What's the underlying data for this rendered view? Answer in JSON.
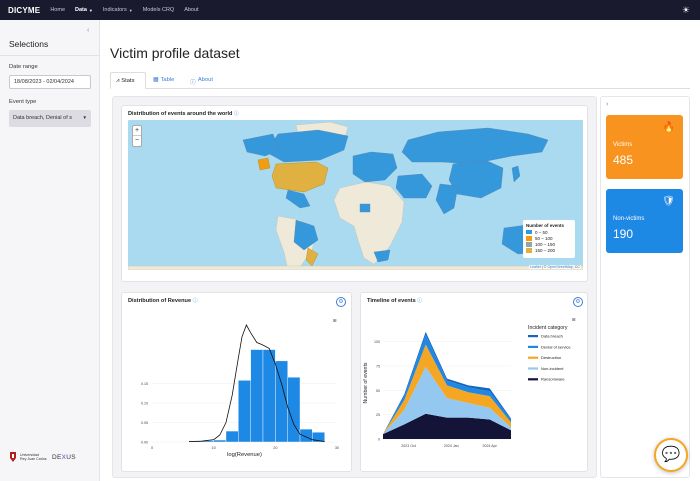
{
  "navbar": {
    "brand": "DICYME",
    "items": [
      {
        "label": "Home"
      },
      {
        "label": "Data",
        "active": true,
        "dropdown": true
      },
      {
        "label": "Indicators",
        "dropdown": true
      },
      {
        "label": "Models CRQ"
      },
      {
        "label": "About"
      }
    ],
    "theme_icon": "sun-icon"
  },
  "sidebar": {
    "title": "Selections",
    "date_range_label": "Date range",
    "date_range_value": "18/08/2023 - 02/04/2024",
    "event_type_label": "Event type",
    "event_type_value": "Data breach, Denial of s",
    "logo_urjc_line1": "Universidad",
    "logo_urjc_line2": "Rey Juan Carlos",
    "logo_dexus_pre": "DE",
    "logo_dexus_mid": "X",
    "logo_dexus_post": "US"
  },
  "page": {
    "title": "Victim profile dataset",
    "tabs": [
      {
        "label": "Stats",
        "icon": "chart-icon",
        "active": true
      },
      {
        "label": "Table",
        "icon": "table-icon"
      },
      {
        "label": "About",
        "icon": "info-icon"
      }
    ]
  },
  "map_card": {
    "title": "Distribution of events around the world",
    "zoom_in": "+",
    "zoom_out": "−",
    "legend_title": "Number of events",
    "legend": [
      {
        "label": "0 – 50",
        "color": "#3498db"
      },
      {
        "label": "50 – 100",
        "color": "#f39c12"
      },
      {
        "label": "100 – 150",
        "color": "#95a5a6"
      },
      {
        "label": "150 – 200",
        "color": "#e0b040"
      }
    ],
    "attribution_a": "Leaflet",
    "attribution_sep": " | © ",
    "attribution_b": "OpenStreetMap",
    "attribution_c": ", CC"
  },
  "revenue_card": {
    "title": "Distribution of Revenue"
  },
  "timeline_card": {
    "title": "Timeline of events"
  },
  "stats": {
    "victims_label": "Victims",
    "victims_value": "485",
    "victims_color": "#f7931e",
    "nonvictims_label": "Non-victims",
    "nonvictims_value": "190",
    "nonvictims_color": "#1e88e5"
  },
  "chart_data": [
    {
      "type": "bar",
      "title": "Distribution of Revenue",
      "xlabel": "log(Revenue)",
      "ylabel": "",
      "bin_edges": [
        4,
        6,
        8,
        10,
        12,
        14,
        16,
        18,
        20,
        22,
        24,
        26,
        28
      ],
      "values": [
        0.0,
        0.003,
        0.003,
        0.005,
        0.028,
        0.158,
        0.237,
        0.237,
        0.208,
        0.166,
        0.033,
        0.025
      ],
      "density_curve": [
        [
          6,
          0.001
        ],
        [
          8,
          0.002
        ],
        [
          10,
          0.006
        ],
        [
          11,
          0.018
        ],
        [
          12,
          0.05
        ],
        [
          13,
          0.12
        ],
        [
          14,
          0.215
        ],
        [
          14.6,
          0.27
        ],
        [
          15.3,
          0.3
        ],
        [
          16,
          0.28
        ],
        [
          17,
          0.255
        ],
        [
          17.8,
          0.25
        ],
        [
          19,
          0.24
        ],
        [
          20,
          0.2
        ],
        [
          21,
          0.15
        ],
        [
          22,
          0.09
        ],
        [
          23,
          0.045
        ],
        [
          24,
          0.02
        ],
        [
          26,
          0.006
        ],
        [
          28,
          0.001
        ]
      ],
      "xlim": [
        0,
        30
      ],
      "ylim": [
        0,
        0.3
      ],
      "xticks": [
        0,
        10,
        20,
        30
      ],
      "yticks": [
        0,
        0.05,
        0.1,
        0.15
      ],
      "bar_color": "#1e88e5"
    },
    {
      "type": "area",
      "stacked": true,
      "title": "Timeline of events",
      "ylabel": "Number of events",
      "x": [
        0,
        1,
        2,
        3,
        4,
        5,
        6
      ],
      "x_ticks": [
        {
          "pos": 1.2,
          "label": "2023 Oct"
        },
        {
          "pos": 3.2,
          "label": "2024 Jan"
        },
        {
          "pos": 5.0,
          "label": "2024 Apr"
        }
      ],
      "legend_title": "Incident category",
      "series": [
        {
          "name": "Ransomware",
          "color": "#141438",
          "values": [
            5,
            15,
            26,
            22,
            22,
            20,
            9
          ]
        },
        {
          "name": "Non-incident",
          "color": "#95c8f0",
          "values": [
            0,
            15,
            48,
            20,
            15,
            12,
            3
          ]
        },
        {
          "name": "Destruction",
          "color": "#f5a623",
          "values": [
            0,
            10,
            23,
            13,
            11,
            12,
            5
          ]
        },
        {
          "name": "Denial of service",
          "color": "#1e88e5",
          "values": [
            0,
            4,
            10,
            5,
            5,
            5,
            3
          ]
        },
        {
          "name": "Data breach",
          "color": "#1565c0",
          "values": [
            0,
            2,
            3,
            2,
            2,
            3,
            1
          ]
        }
      ],
      "ylim": [
        0,
        115
      ],
      "yticks": [
        0,
        25,
        50,
        75,
        100
      ]
    }
  ],
  "chat_icon": "chat-bubble-icon"
}
